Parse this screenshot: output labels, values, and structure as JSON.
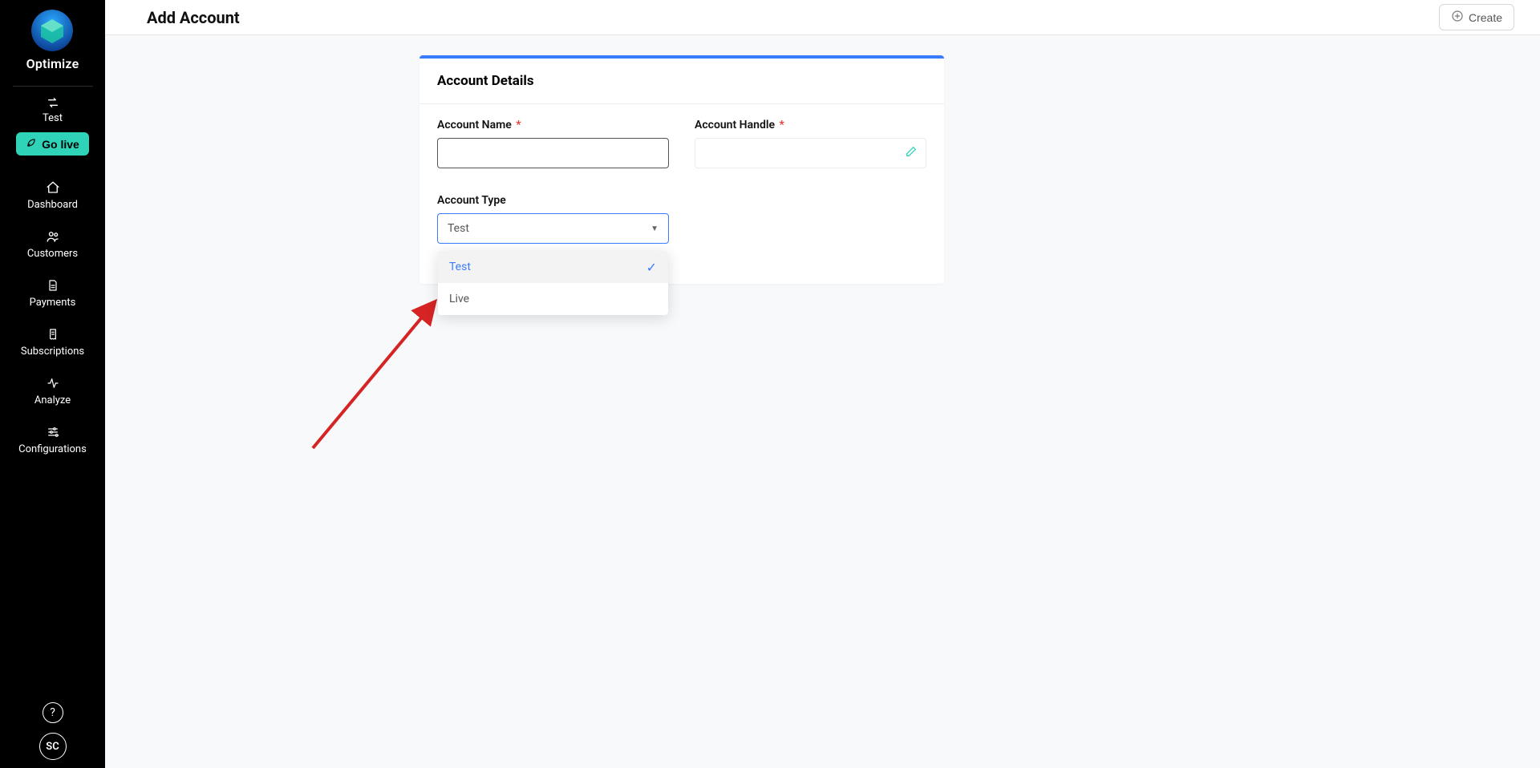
{
  "brand": "Optimize",
  "mode_label": "Test",
  "go_live_label": "Go live",
  "nav": {
    "dashboard": "Dashboard",
    "customers": "Customers",
    "payments": "Payments",
    "subscriptions": "Subscriptions",
    "analyze": "Analyze",
    "configurations": "Configurations"
  },
  "help_glyph": "?",
  "avatar_initials": "SC",
  "page_title": "Add Account",
  "create_label": "Create",
  "card": {
    "title": "Account Details",
    "account_name_label": "Account Name",
    "account_handle_label": "Account Handle",
    "account_type_label": "Account Type",
    "account_type_value": "Test",
    "account_type_options": {
      "test": "Test",
      "live": "Live"
    },
    "required_glyph": "*"
  }
}
